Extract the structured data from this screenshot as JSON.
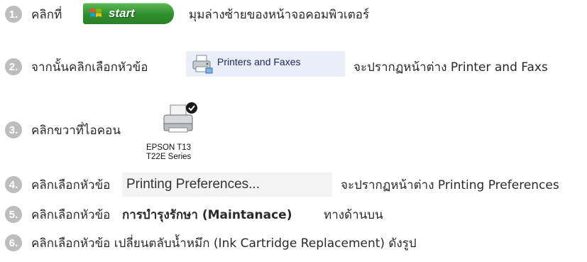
{
  "steps": [
    {
      "num": "1.",
      "text": "คลิกที่",
      "tail": "มุมล่างซ้ายของหน้าจอคอมพิวเตอร์"
    },
    {
      "num": "2.",
      "text": "จากนั้นคลิกเลือกหัวข้อ",
      "tail": "จะปรากฏหน้าต่าง Printer and Faxs"
    },
    {
      "num": "3.",
      "text": "คลิกขวาที่ไอคอน"
    },
    {
      "num": "4.",
      "text": "คลิกเลือกหัวข้อ",
      "tail": "จะปรากฏหน้าต่าง Printing Preferences"
    },
    {
      "num": "5.",
      "text": "คลิกเลือกหัวข้อ",
      "bold": "การบำรุงรักษา (Maintanace)",
      "tail": "ทางด้านบน"
    },
    {
      "num": "6.",
      "text": "คลิกเลือกหัวข้อ เปลี่ยนตลับน้ำหมึก (Ink Cartridge Replacement) ดังรูป"
    }
  ],
  "start_button": {
    "label": "start",
    "icon": "windows-flag-icon"
  },
  "printers_faxes": {
    "label": "Printers and Faxes",
    "icon": "printer-fax-icon"
  },
  "epson": {
    "line1": "EPSON T13",
    "line2": "T22E Series",
    "icon": "printer-icon"
  },
  "printing_prefs": {
    "label": "Printing Preferences..."
  },
  "colors": {
    "num_circle": "#bdbdbd",
    "start_green": "#2f8f2c",
    "pf_bg": "#e9eef7"
  }
}
